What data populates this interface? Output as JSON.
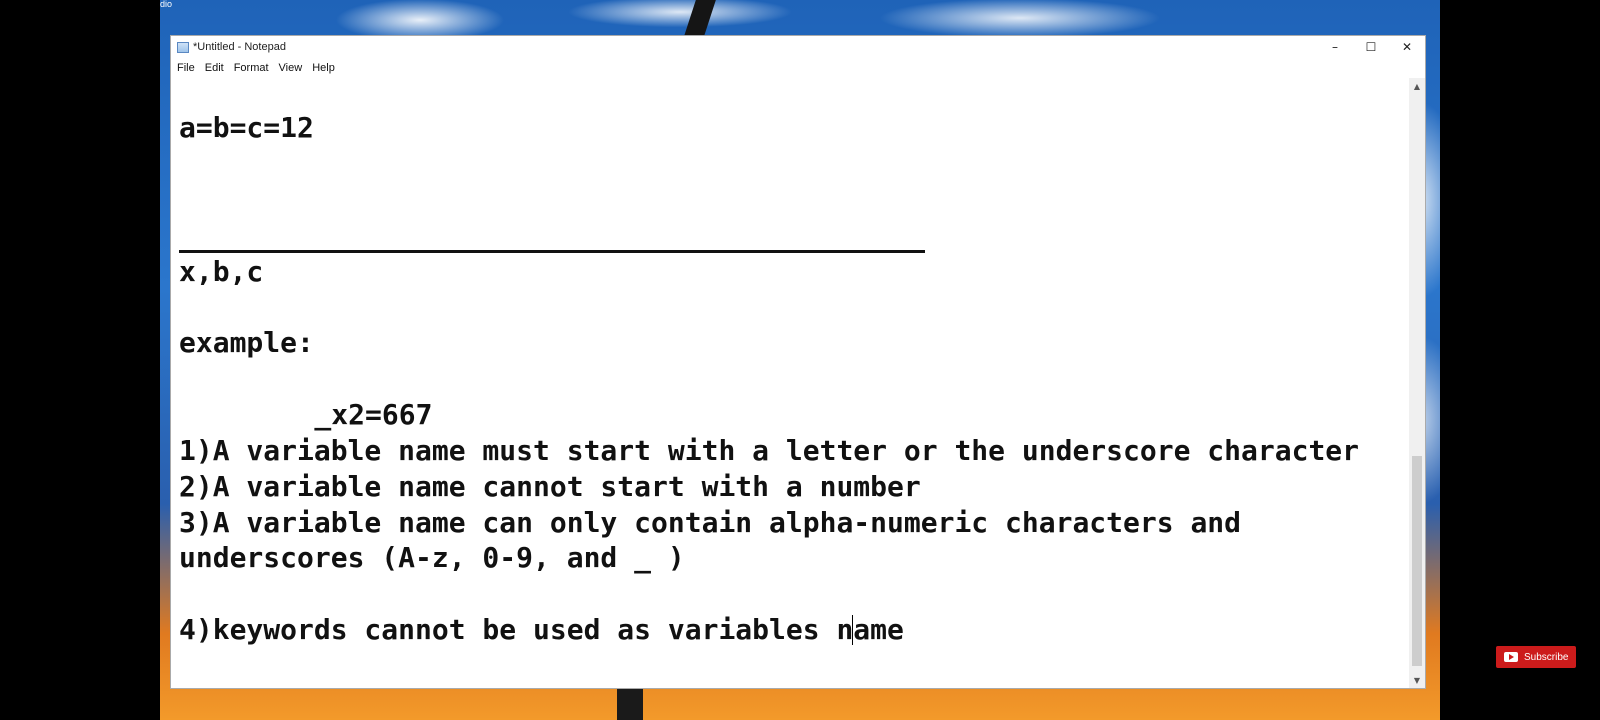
{
  "window": {
    "title": "*Untitled - Notepad",
    "controls": {
      "minimize": "–",
      "maximize": "☐",
      "close": "✕"
    }
  },
  "menu": {
    "items": [
      "File",
      "Edit",
      "Format",
      "View",
      "Help"
    ]
  },
  "editor": {
    "lines": [
      "a=b=c=12",
      "x,b,c",
      "example:",
      "    _x2=667",
      "1)A variable name must start with a letter or the underscore character",
      "2)A variable name cannot start with a number",
      "3)A variable name can only contain alpha-numeric characters and",
      "underscores (A-z, 0-9, and _ )",
      "4)keywords cannot be used as variables n",
      "ame"
    ]
  },
  "scrollbar": {
    "up_icon": "chevron-up-icon",
    "down_icon": "chevron-down-icon"
  },
  "desktop": {
    "corner_text": "dio"
  },
  "youtube": {
    "subscribe_label": "Subscribe",
    "color": "#cc1b1b"
  }
}
